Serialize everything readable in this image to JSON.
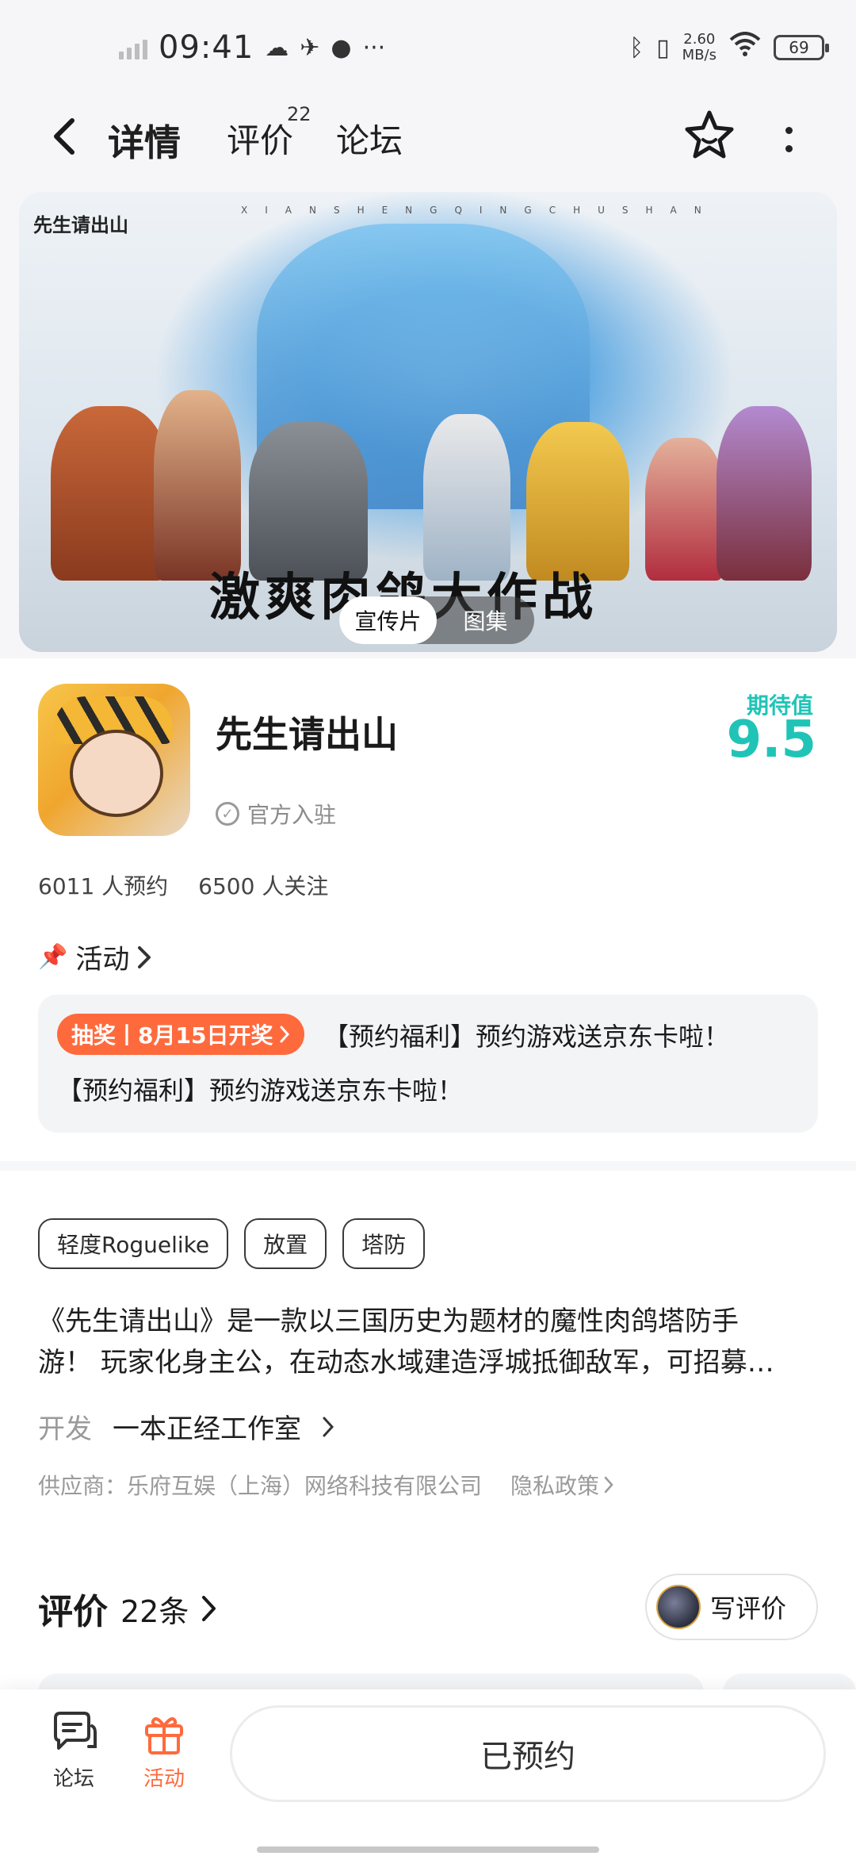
{
  "status_bar": {
    "time": "09:41",
    "network_speed_value": "2.60",
    "network_speed_unit": "MB/s",
    "battery": "69",
    "icons": [
      "signal-icon",
      "cloud-icon",
      "bird-icon",
      "flame-icon",
      "more-dots-icon",
      "bluetooth-icon",
      "vibrate-icon",
      "wifi-icon",
      "battery-icon"
    ]
  },
  "header": {
    "tabs": [
      {
        "label": "详情",
        "active": true
      },
      {
        "label": "评价",
        "badge": "22"
      },
      {
        "label": "论坛"
      }
    ],
    "accent_color": "#20c4b7"
  },
  "banner": {
    "logo_text": "先生请出山",
    "subtitle": "XIANSHENGQINGCHUSHAN",
    "slogan": "激爽肉鸽大作战",
    "media_options": [
      "宣传片",
      "图集"
    ],
    "active_media": "宣传片"
  },
  "game": {
    "title": "先生请出山",
    "official_label": "官方入驻",
    "expect_label": "期待值",
    "expect_value": "9.5",
    "reservations": "6011 人预约",
    "followers": "6500 人关注"
  },
  "activity": {
    "header": "活动",
    "tag": "抽奖丨8月15日开奖",
    "line1": "【预约福利】预约游戏送京东卡啦！",
    "line2": "【预约福利】预约游戏送京东卡啦！",
    "tag_color": "#ff6a3d"
  },
  "tags": [
    "轻度Roguelike",
    "放置",
    "塔防"
  ],
  "description": {
    "line1": "《先生请出山》是一款以三国历史为题材的魔性肉鸽塔防手",
    "line2": "游！ 玩家化身主公，在动态水域建造浮城抵御敌军，可招募…"
  },
  "developer": {
    "label": "开发",
    "name": "一本正经工作室"
  },
  "supplier": {
    "text": "供应商：乐府互娱（上海）网络科技有限公司",
    "privacy": "隐私政策"
  },
  "reviews": {
    "title": "评价",
    "count": "22条",
    "write_label": "写评价"
  },
  "bottom_nav": {
    "forum": "论坛",
    "activity": "活动",
    "reserve_button": "已预约"
  }
}
